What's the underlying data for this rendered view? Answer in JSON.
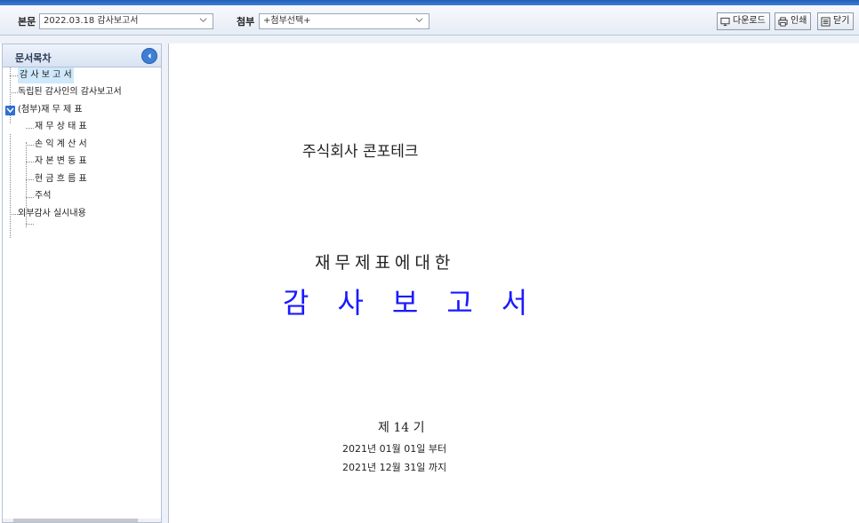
{
  "toolbar": {
    "main_label": "본문",
    "main_select": "2022.03.18  감사보고서",
    "attach_label": "첨부",
    "attach_select": "+첨부선택+",
    "download": "다운로드",
    "print": "인쇄",
    "close": "닫기"
  },
  "sidebar": {
    "title": "문서목차",
    "items": [
      "감 사 보 고 서",
      "독립된 감사인의 감사보고서",
      "(첨부)재 무 제 표",
      "재 무 상 태 표",
      "손 익 계 산 서",
      "자 본 변 동 표",
      "현 금 흐 름 표",
      "주석",
      "외부감사 실시내용"
    ]
  },
  "document": {
    "company": "주식회사 콘포테크",
    "subtitle": "재무제표에대한",
    "title": "감사보고서",
    "period": "제 14 기",
    "date_from": "2021년 01월 01일  부터",
    "date_to": "2021년 12월 31일  까지"
  },
  "colors": {
    "accent": "#3d7fd6",
    "title_blue": "#1a1aff",
    "selection": "#cfe8fb"
  }
}
